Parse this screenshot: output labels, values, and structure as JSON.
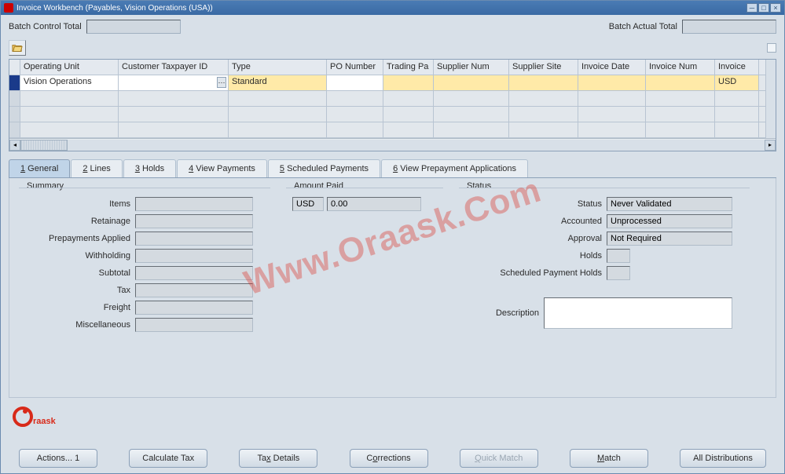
{
  "window": {
    "title": "Invoice Workbench (Payables, Vision Operations (USA))"
  },
  "batch": {
    "control_label": "Batch Control Total",
    "actual_label": "Batch Actual Total"
  },
  "grid": {
    "headers": [
      "Operating Unit",
      "Customer Taxpayer ID",
      "Type",
      "PO Number",
      "Trading Pa",
      "Supplier Num",
      "Supplier Site",
      "Invoice Date",
      "Invoice Num",
      "Invoice"
    ],
    "rows": [
      {
        "operating_unit": "Vision Operations",
        "customer_tax_id": "",
        "type": "Standard",
        "po_number": "",
        "trading_pa": "",
        "supplier_num": "",
        "supplier_site": "",
        "invoice_date": "",
        "invoice_num": "",
        "invoice": "USD"
      }
    ]
  },
  "tabs": [
    {
      "num": "1",
      "label": " General"
    },
    {
      "num": "2",
      "label": " Lines"
    },
    {
      "num": "3",
      "label": " Holds"
    },
    {
      "num": "4",
      "label": " View Payments"
    },
    {
      "num": "5",
      "label": " Scheduled Payments"
    },
    {
      "num": "6",
      "label": " View Prepayment Applications"
    }
  ],
  "summary": {
    "legend": "Summary",
    "labels": {
      "items": "Items",
      "retainage": "Retainage",
      "prepay": "Prepayments Applied",
      "withholding": "Withholding",
      "subtotal": "Subtotal",
      "tax": "Tax",
      "freight": "Freight",
      "misc": "Miscellaneous"
    }
  },
  "amount_paid": {
    "legend": "Amount Paid",
    "currency": "USD",
    "value": "0.00"
  },
  "status": {
    "legend": "Status",
    "labels": {
      "status": "Status",
      "accounted": "Accounted",
      "approval": "Approval",
      "holds": "Holds",
      "sched": "Scheduled Payment Holds",
      "desc": "Description"
    },
    "values": {
      "status": "Never Validated",
      "accounted": "Unprocessed",
      "approval": "Not Required"
    }
  },
  "buttons": {
    "actions": "Actions... 1",
    "calc_tax": "Calculate Tax",
    "tax_details": "Tax Details",
    "corrections": "Corrections",
    "quick_match": "Quick Match",
    "match": "Match",
    "all_dist": "All Distributions"
  },
  "watermark": "Www.Oraask.Com",
  "logo_text": "raask"
}
